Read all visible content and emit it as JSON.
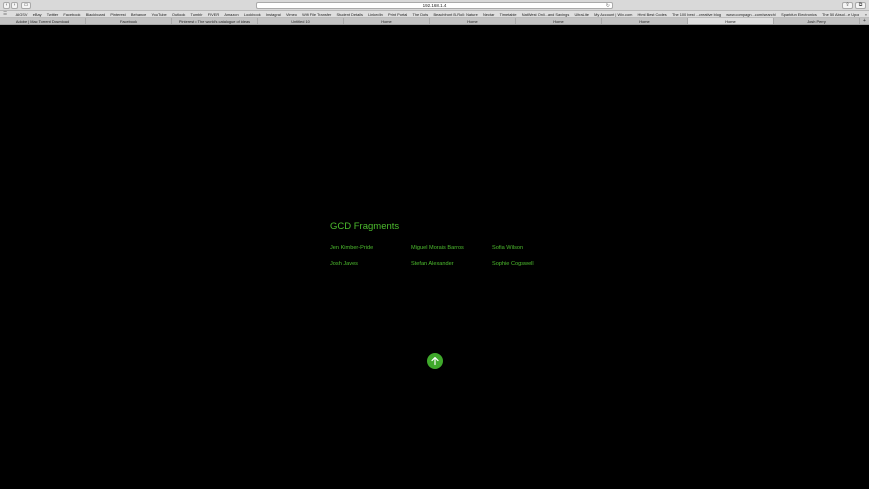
{
  "browser": {
    "address": "192.168.1.4",
    "buttons": {
      "back": "‹",
      "forward": "›",
      "sidebar": "▭",
      "reload": "↻",
      "share": "⇪",
      "tabs_overview": "⧉"
    },
    "bookmarks_icon": "☰",
    "bookmarks_more": "»",
    "bookmarks": [
      "AIGSV",
      "eBay",
      "Twitter",
      "Facebook",
      "Blackboard",
      "Pinterest",
      "Behance",
      "YouTube",
      "Outlook",
      "Tumblr",
      "FIVER",
      "Amazon",
      "Lookbook",
      "Instagrai",
      "Vimeo",
      "Wifi File Transfer",
      "Student Details",
      "LinkedIn",
      "Print Portal",
      "The Dots",
      "Beachfront B-Roll: Nature",
      "Nectar",
      "Timetable",
      "NatWest Onli...and Savings",
      "UltraLite",
      "My Account | Wix.com",
      "Html Best Codes",
      "The 100 best ...creative blog",
      "www.compagn...com/search/",
      "Sparkfun Electronics",
      "The 50 Absol...e Upon 10Ps",
      "Student Details"
    ],
    "tabs": [
      {
        "label": "Adobe | Mac Torrent Download",
        "active": false
      },
      {
        "label": "Facebook",
        "active": false
      },
      {
        "label": "Pinterest • The world's catalogue of ideas",
        "active": false
      },
      {
        "label": "Untitled 10",
        "active": false
      },
      {
        "label": "Home",
        "active": false
      },
      {
        "label": "Home",
        "active": false
      },
      {
        "label": "Home",
        "active": false
      },
      {
        "label": "Home",
        "active": false
      },
      {
        "label": "Home",
        "active": true
      },
      {
        "label": "Josh Perry",
        "active": false
      }
    ],
    "new_tab": "+"
  },
  "page": {
    "title": "GCD Fragments",
    "names": [
      "Jen Kimber-Pride",
      "Miguel Morais Barros",
      "Sofia Wilson",
      "Josh Javes",
      "Stefan Alexander",
      "Sophie Cogswell"
    ],
    "up_button_icon": "arrow-up-icon",
    "accent_color": "#4dbd2e"
  }
}
